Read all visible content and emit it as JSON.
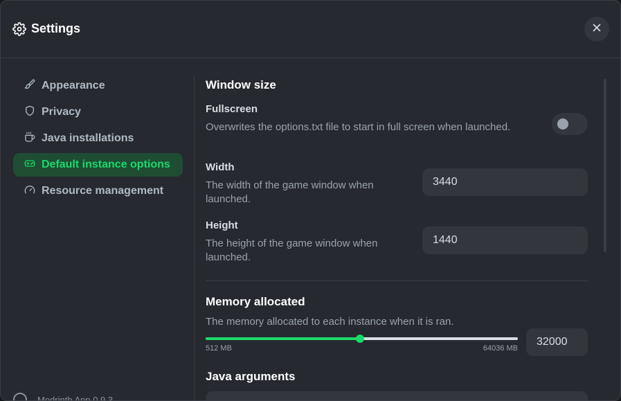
{
  "header": {
    "title": "Settings"
  },
  "sidebar": {
    "items": [
      {
        "label": "Appearance",
        "icon": "paintbrush-icon"
      },
      {
        "label": "Privacy",
        "icon": "shield-icon"
      },
      {
        "label": "Java installations",
        "icon": "coffee-icon"
      },
      {
        "label": "Default instance options",
        "icon": "gamepad-icon",
        "active": true
      },
      {
        "label": "Resource management",
        "icon": "gauge-icon"
      }
    ],
    "version": "Modrinth App 0.9.3"
  },
  "window_size": {
    "title": "Window size",
    "fullscreen": {
      "label": "Fullscreen",
      "description": "Overwrites the options.txt file to start in full screen when launched.",
      "enabled": false
    },
    "width": {
      "label": "Width",
      "description": "The width of the game window when launched.",
      "value": "3440"
    },
    "height": {
      "label": "Height",
      "description": "The height of the game window when launched.",
      "value": "1440"
    }
  },
  "memory": {
    "title": "Memory allocated",
    "description": "The memory allocated to each instance when it is ran.",
    "min_label": "512 MB",
    "max_label": "64036 MB",
    "value": "32000",
    "fraction": 0.495
  },
  "java_args": {
    "title": "Java arguments"
  },
  "colors": {
    "accent": "#1bd96a",
    "active_bg": "#1e4d33",
    "panel": "#26292f",
    "input": "#33363d"
  }
}
